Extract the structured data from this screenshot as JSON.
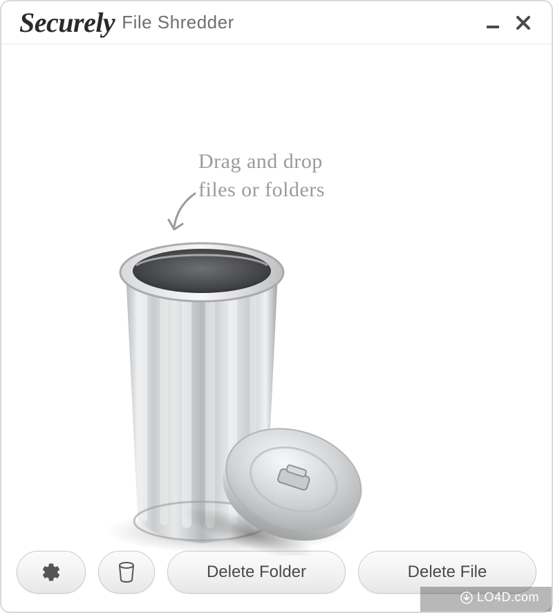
{
  "titlebar": {
    "brand": "Securely",
    "subtitle": "File Shredder"
  },
  "body": {
    "hint_line1": "Drag and drop",
    "hint_line2": "files or folders"
  },
  "footer": {
    "delete_folder_label": "Delete Folder",
    "delete_file_label": "Delete File"
  },
  "watermark": {
    "text": "LO4D.com"
  }
}
